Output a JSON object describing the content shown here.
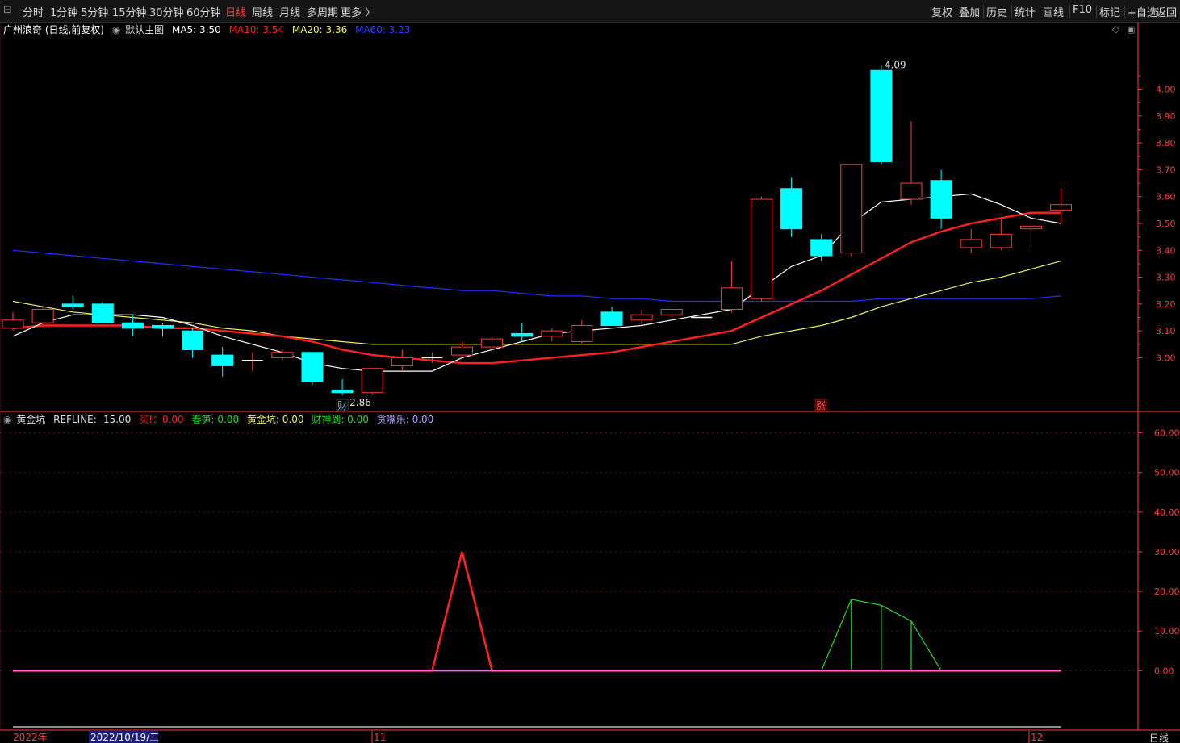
{
  "toolbar": {
    "timeframes": [
      "分时",
      "1分钟",
      "5分钟",
      "15分钟",
      "30分钟",
      "60分钟",
      "日线",
      "周线",
      "月线",
      "多周期",
      "更多 〉"
    ],
    "active_timeframe": "日线",
    "right_buttons": [
      "复权",
      "叠加",
      "历史",
      "统计",
      "画线",
      "F10",
      "标记",
      "+自选",
      "返回"
    ]
  },
  "main_legend": {
    "stock": "广州浪奇 (日线,前复权)",
    "template": "默认主图",
    "ma5": "MA5: 3.50",
    "ma10": "MA10: 3.54",
    "ma20": "MA20: 3.36",
    "ma60": "MA60: 3.23"
  },
  "sub_legend": {
    "name": "黄金坑",
    "refline": "REFLINE: -15.00",
    "buy": "买!：0.00",
    "spring": "春笋: 0.00",
    "pit": "黄金坑: 0.00",
    "god": "财神到: 0.00",
    "greedy": "贪嘴乐: 0.00"
  },
  "colors": {
    "up": "#ff3b3b",
    "down": "#00ffff",
    "ma5": "#ffffff",
    "ma10": "#ff2020",
    "ma20": "#f0f060",
    "ma60": "#2030ff",
    "axis": "#ff3b3b",
    "buy": "#ff2020",
    "spring": "#22dd22",
    "refline": "#ff66ff"
  },
  "chart_data": [
    {
      "type": "candlestick",
      "title": "广州浪奇 (日线,前复权)",
      "ylim": [
        2.8,
        4.2
      ],
      "y_ticks": [
        3.0,
        3.1,
        3.2,
        3.3,
        3.4,
        3.5,
        3.6,
        3.7,
        3.8,
        3.9,
        4.0
      ],
      "candles": [
        {
          "o": 3.11,
          "h": 3.17,
          "l": 3.1,
          "c": 3.14
        },
        {
          "o": 3.13,
          "h": 3.19,
          "l": 3.12,
          "c": 3.18
        },
        {
          "o": 3.2,
          "h": 3.23,
          "l": 3.18,
          "c": 3.19
        },
        {
          "o": 3.2,
          "h": 3.21,
          "l": 3.13,
          "c": 3.13
        },
        {
          "o": 3.13,
          "h": 3.16,
          "l": 3.08,
          "c": 3.11
        },
        {
          "o": 3.12,
          "h": 3.13,
          "l": 3.08,
          "c": 3.11
        },
        {
          "o": 3.1,
          "h": 3.11,
          "l": 3.0,
          "c": 3.03
        },
        {
          "o": 3.01,
          "h": 3.04,
          "l": 2.93,
          "c": 2.97
        },
        {
          "o": 2.99,
          "h": 3.02,
          "l": 2.95,
          "c": 2.99
        },
        {
          "o": 3.0,
          "h": 3.03,
          "l": 2.99,
          "c": 3.02
        },
        {
          "o": 3.02,
          "h": 3.02,
          "l": 2.9,
          "c": 2.91
        },
        {
          "o": 2.88,
          "h": 2.92,
          "l": 2.86,
          "c": 2.87
        },
        {
          "o": 2.87,
          "h": 2.96,
          "l": 2.86,
          "c": 2.96
        },
        {
          "o": 2.97,
          "h": 3.03,
          "l": 2.95,
          "c": 3.0
        },
        {
          "o": 3.0,
          "h": 3.02,
          "l": 2.98,
          "c": 3.0
        },
        {
          "o": 3.01,
          "h": 3.06,
          "l": 3.0,
          "c": 3.04
        },
        {
          "o": 3.04,
          "h": 3.08,
          "l": 3.03,
          "c": 3.07
        },
        {
          "o": 3.09,
          "h": 3.13,
          "l": 3.06,
          "c": 3.08
        },
        {
          "o": 3.08,
          "h": 3.11,
          "l": 3.06,
          "c": 3.1
        },
        {
          "o": 3.06,
          "h": 3.14,
          "l": 3.05,
          "c": 3.12
        },
        {
          "o": 3.17,
          "h": 3.19,
          "l": 3.12,
          "c": 3.12
        },
        {
          "o": 3.14,
          "h": 3.18,
          "l": 3.12,
          "c": 3.16
        },
        {
          "o": 3.16,
          "h": 3.18,
          "l": 3.15,
          "c": 3.18
        },
        {
          "o": 3.15,
          "h": 3.15,
          "l": 3.15,
          "c": 3.15
        },
        {
          "o": 3.18,
          "h": 3.36,
          "l": 3.17,
          "c": 3.26
        },
        {
          "o": 3.22,
          "h": 3.6,
          "l": 3.21,
          "c": 3.59
        },
        {
          "o": 3.63,
          "h": 3.67,
          "l": 3.45,
          "c": 3.48
        },
        {
          "o": 3.44,
          "h": 3.46,
          "l": 3.36,
          "c": 3.38
        },
        {
          "o": 3.39,
          "h": 3.72,
          "l": 3.38,
          "c": 3.72
        },
        {
          "o": 4.07,
          "h": 4.09,
          "l": 3.72,
          "c": 3.73
        },
        {
          "o": 3.59,
          "h": 3.88,
          "l": 3.57,
          "c": 3.65
        },
        {
          "o": 3.66,
          "h": 3.7,
          "l": 3.48,
          "c": 3.52
        },
        {
          "o": 3.41,
          "h": 3.48,
          "l": 3.39,
          "c": 3.44
        },
        {
          "o": 3.41,
          "h": 3.52,
          "l": 3.4,
          "c": 3.46
        },
        {
          "o": 3.48,
          "h": 3.52,
          "l": 3.41,
          "c": 3.49
        },
        {
          "o": 3.55,
          "h": 3.63,
          "l": 3.5,
          "c": 3.57
        }
      ],
      "ma5": [
        3.08,
        3.13,
        3.16,
        3.16,
        3.16,
        3.15,
        3.12,
        3.08,
        3.05,
        3.02,
        2.98,
        2.96,
        2.95,
        2.95,
        2.95,
        3.0,
        3.03,
        3.06,
        3.09,
        3.1,
        3.11,
        3.12,
        3.14,
        3.16,
        3.18,
        3.26,
        3.34,
        3.38,
        3.5,
        3.58,
        3.59,
        3.6,
        3.61,
        3.57,
        3.52,
        3.5
      ],
      "ma10": [
        3.11,
        3.12,
        3.12,
        3.12,
        3.12,
        3.11,
        3.11,
        3.1,
        3.09,
        3.08,
        3.06,
        3.03,
        3.01,
        3.0,
        2.99,
        2.98,
        2.98,
        2.99,
        3.0,
        3.01,
        3.02,
        3.04,
        3.06,
        3.08,
        3.1,
        3.15,
        3.2,
        3.25,
        3.31,
        3.37,
        3.43,
        3.47,
        3.5,
        3.52,
        3.54,
        3.54
      ],
      "ma20": [
        3.21,
        3.19,
        3.17,
        3.16,
        3.15,
        3.14,
        3.13,
        3.11,
        3.1,
        3.08,
        3.07,
        3.06,
        3.05,
        3.05,
        3.05,
        3.05,
        3.05,
        3.05,
        3.05,
        3.05,
        3.05,
        3.05,
        3.05,
        3.05,
        3.05,
        3.08,
        3.1,
        3.12,
        3.15,
        3.19,
        3.22,
        3.25,
        3.28,
        3.3,
        3.33,
        3.36
      ],
      "ma60": [
        3.4,
        3.39,
        3.38,
        3.37,
        3.36,
        3.35,
        3.34,
        3.33,
        3.32,
        3.31,
        3.3,
        3.29,
        3.28,
        3.27,
        3.26,
        3.25,
        3.25,
        3.24,
        3.23,
        3.23,
        3.22,
        3.22,
        3.21,
        3.21,
        3.21,
        3.21,
        3.21,
        3.21,
        3.21,
        3.22,
        3.22,
        3.22,
        3.22,
        3.22,
        3.22,
        3.23
      ],
      "annotations": {
        "low_label": "←2.86",
        "high_label": "4.09",
        "cai_tag": "财",
        "zhang_tag": "涨"
      }
    },
    {
      "type": "line",
      "title": "黄金坑",
      "ylim": [
        -15,
        65
      ],
      "y_ticks": [
        0,
        10,
        20,
        30,
        40,
        50,
        60
      ],
      "refline": -15,
      "buy": [
        0,
        0,
        0,
        0,
        0,
        0,
        0,
        0,
        0,
        0,
        0,
        0,
        0,
        0,
        0,
        30,
        0,
        0,
        0,
        0,
        0,
        0,
        0,
        0,
        0,
        0,
        0,
        0,
        0,
        0,
        0,
        0,
        0,
        0,
        0,
        0
      ],
      "spring": [
        0,
        0,
        0,
        0,
        0,
        0,
        0,
        0,
        0,
        0,
        0,
        0,
        0,
        0,
        0,
        0,
        0,
        0,
        0,
        0,
        0,
        0,
        0,
        0,
        0,
        0,
        0,
        0,
        18,
        16.5,
        12.5,
        0,
        0,
        0,
        0,
        0
      ]
    }
  ],
  "bottom_axis": {
    "year": "2022年",
    "date": "2022/10/19/三",
    "m11": "11",
    "m12": "12",
    "period": "日线"
  }
}
